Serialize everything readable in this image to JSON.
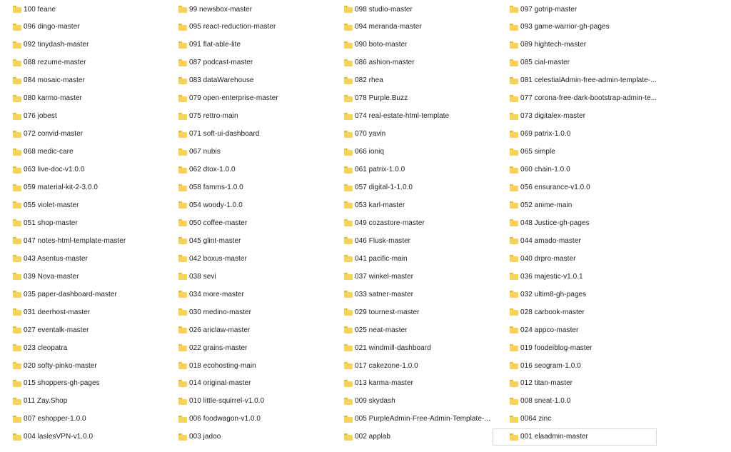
{
  "colors": {
    "folder": "#f7d35c",
    "folder_tab": "#e8b83a",
    "focus_border": "#d8d8d8"
  },
  "icon": "folder-icon",
  "focused_item": "001 elaadmin-master",
  "folders": [
    [
      "100 feane",
      "99 newsbox-master",
      "098 studio-master",
      "097 gotrip-master"
    ],
    [
      "096 dingo-master",
      "095 react-reduction-master",
      "094 meranda-master",
      "093 game-warrior-gh-pages"
    ],
    [
      "092 tinydash-master",
      "091 flat-able-lite",
      "090 boto-master",
      "089 hightech-master"
    ],
    [
      "088 rezume-master",
      "087 podcast-master",
      "086 ashion-master",
      "085 cial-master"
    ],
    [
      "084 mosaic-master",
      "083 dataWarehouse",
      "082 rhea",
      "081 celestialAdmin-free-admin-template-..."
    ],
    [
      "080 karmo-master",
      "079 open-enterprise-master",
      "078 Purple.Buzz",
      "077 corona-free-dark-bootstrap-admin-te..."
    ],
    [
      "076 jobest",
      "075 rettro-main",
      "074 real-estate-html-template",
      "073 digitalex-master"
    ],
    [
      "072 convid-master",
      "071 soft-ui-dashboard",
      "070 yavin",
      "069 patrix-1.0.0"
    ],
    [
      "068 medic-care",
      "067 nubis",
      "066 ioniq",
      "065 simple"
    ],
    [
      "063 live-doc-v1.0.0",
      "062 dtox-1.0.0",
      "061 patrix-1.0.0",
      "060 chain-1.0.0"
    ],
    [
      "059 material-kit-2-3.0.0",
      "058 famms-1.0.0",
      "057 digital-1-1.0.0",
      "056 ensurance-v1.0.0"
    ],
    [
      "055 violet-master",
      "054 woody-1.0.0",
      "053 karl-master",
      "052 anime-main"
    ],
    [
      "051 shop-master",
      "050 coffee-master",
      "049 cozastore-master",
      "048 Justice-gh-pages"
    ],
    [
      "047 notes-html-template-master",
      "045 glint-master",
      "046 Flusk-master",
      "044 amado-master"
    ],
    [
      "043 Asentus-master",
      "042 boxus-master",
      "041 pacific-main",
      "040 drpro-master"
    ],
    [
      "039 Nova-master",
      "038 sevi",
      "037 winkel-master",
      "036 majestic-v1.0.1"
    ],
    [
      "035 paper-dashboard-master",
      "034 more-master",
      "033 satner-master",
      "032 ultim8-gh-pages"
    ],
    [
      "031 deerhost-master",
      "030 medino-master",
      "029 tournest-master",
      "028 carbook-master"
    ],
    [
      "027 eventalk-master",
      "026 ariclaw-master",
      "025 neat-master",
      "024 appco-master"
    ],
    [
      "023 cleopatra",
      "022 grains-master",
      "021 windmill-dashboard",
      "019 foodeiblog-master"
    ],
    [
      "020 softy-pinko-master",
      "018 ecohosting-main",
      "017 cakezone-1.0.0",
      "016 seogram-1.0.0"
    ],
    [
      "015 shoppers-gh-pages",
      "014 original-master",
      "013 karma-master",
      "012 titan-master"
    ],
    [
      "011 Zay.Shop",
      "010 little-squirrel-v1.0.0",
      "009 skydash",
      "008 sneat-1.0.0"
    ],
    [
      "007 eshopper-1.0.0",
      "006 foodwagon-v1.0.0",
      "005 PurpleAdmin-Free-Admin-Template-...",
      "0064 zinc"
    ],
    [
      "004 laslesVPN-v1.0.0",
      "003 jadoo",
      "002 applab",
      "001 elaadmin-master"
    ]
  ]
}
